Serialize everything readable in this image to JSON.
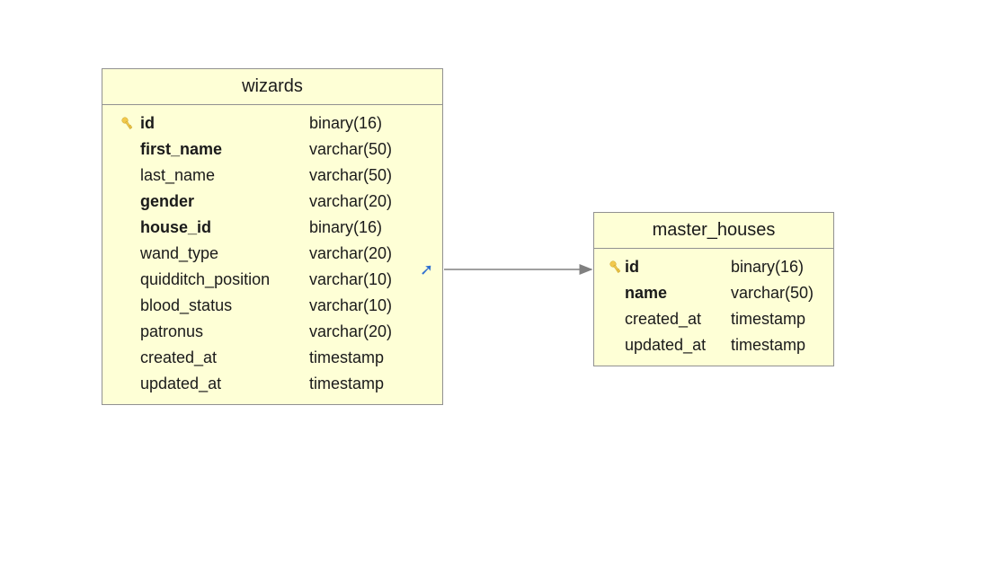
{
  "tables": {
    "wizards": {
      "title": "wizards",
      "columns": [
        {
          "key": true,
          "bold": true,
          "name": "id",
          "type": "binary(16)",
          "fk": false
        },
        {
          "key": false,
          "bold": true,
          "name": "first_name",
          "type": "varchar(50)",
          "fk": false
        },
        {
          "key": false,
          "bold": false,
          "name": "last_name",
          "type": "varchar(50)",
          "fk": false
        },
        {
          "key": false,
          "bold": true,
          "name": "gender",
          "type": "varchar(20)",
          "fk": false
        },
        {
          "key": false,
          "bold": true,
          "name": "house_id",
          "type": "binary(16)",
          "fk": true
        },
        {
          "key": false,
          "bold": false,
          "name": "wand_type",
          "type": "varchar(20)",
          "fk": false
        },
        {
          "key": false,
          "bold": false,
          "name": "quidditch_position",
          "type": "varchar(10)",
          "fk": false
        },
        {
          "key": false,
          "bold": false,
          "name": "blood_status",
          "type": "varchar(10)",
          "fk": false
        },
        {
          "key": false,
          "bold": false,
          "name": "patronus",
          "type": "varchar(20)",
          "fk": false
        },
        {
          "key": false,
          "bold": false,
          "name": "created_at",
          "type": "timestamp",
          "fk": false
        },
        {
          "key": false,
          "bold": false,
          "name": "updated_at",
          "type": "timestamp",
          "fk": false
        }
      ]
    },
    "master_houses": {
      "title": "master_houses",
      "columns": [
        {
          "key": true,
          "bold": true,
          "name": "id",
          "type": "binary(16)"
        },
        {
          "key": false,
          "bold": true,
          "name": "name",
          "type": "varchar(50)"
        },
        {
          "key": false,
          "bold": false,
          "name": "created_at",
          "type": "timestamp"
        },
        {
          "key": false,
          "bold": false,
          "name": "updated_at",
          "type": "timestamp"
        }
      ]
    }
  },
  "relation": {
    "from_table": "wizards",
    "from_column": "house_id",
    "to_table": "master_houses",
    "to_column": "id"
  },
  "fk_glyph": "➚"
}
